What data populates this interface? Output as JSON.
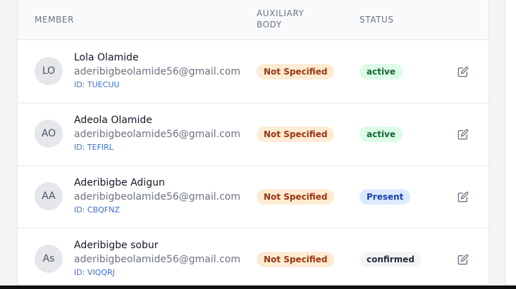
{
  "table": {
    "headers": {
      "member": "MEMBER",
      "auxiliary_body": "AUXILIARY BODY",
      "status": "STATUS"
    },
    "rows": [
      {
        "initials": "LO",
        "name": "Lola Olamide",
        "email": "aderibigbeolamide56@gmail.com",
        "member_id": "ID: TUECUU",
        "auxiliary_body": "Not Specified",
        "status": "active",
        "status_style": {
          "bg": "#dcfce7",
          "fg": "#166534"
        },
        "edit_icon": "edit-icon"
      },
      {
        "initials": "AO",
        "name": "Adeola Olamide",
        "email": "aderibigbeolamide56@gmail.com",
        "member_id": "ID: TEFIRL",
        "auxiliary_body": "Not Specified",
        "status": "active",
        "status_style": {
          "bg": "#dcfce7",
          "fg": "#166534"
        },
        "edit_icon": "edit-icon"
      },
      {
        "initials": "AA",
        "name": "Aderibigbe Adigun",
        "email": "aderibigbeolamide56@gmail.com",
        "member_id": "ID: CBQFNZ",
        "auxiliary_body": "Not Specified",
        "status": "Present",
        "status_style": {
          "bg": "#dbeafe",
          "fg": "#1e40af"
        },
        "edit_icon": "edit-icon"
      },
      {
        "initials": "As",
        "name": "Aderibigbe sobur",
        "email": "aderibigbeolamide56@gmail.com",
        "member_id": "ID: VIQQRJ",
        "auxiliary_body": "Not Specified",
        "status": "confirmed",
        "status_style": {
          "bg": "#f3f4f6",
          "fg": "#1f2937"
        },
        "edit_icon": "edit-icon"
      }
    ]
  },
  "colors": {
    "aux_badge_bg": "#feebd3",
    "aux_badge_fg": "#9a3412",
    "id_link": "#3b6fd1",
    "header_bg": "#f9fafb"
  }
}
